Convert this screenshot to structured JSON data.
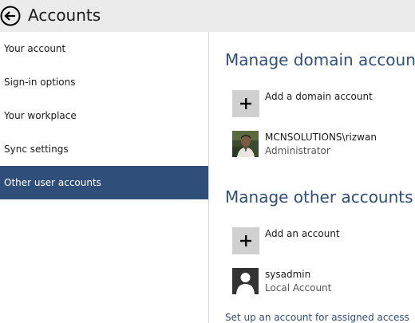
{
  "header": {
    "title": "Accounts",
    "back_icon": "back-arrow-circle-icon"
  },
  "sidebar": {
    "selected_color": "#2f4f7a",
    "items": [
      {
        "label": "Your account"
      },
      {
        "label": "Sign-in options"
      },
      {
        "label": "Your workplace"
      },
      {
        "label": "Sync settings"
      },
      {
        "label": "Other user accounts",
        "selected": true
      }
    ]
  },
  "main": {
    "accent_color": "#2f4f7a",
    "domain_section": {
      "title": "Manage domain accounts",
      "add_label": "Add a domain account",
      "account": {
        "name": "MCNSOLUTIONS\\rizwan",
        "role": "Administrator",
        "avatar": "user-photo"
      }
    },
    "other_section": {
      "title": "Manage other accounts",
      "add_label": "Add an account",
      "account": {
        "name": "sysadmin",
        "role": "Local Account",
        "avatar": "default-user-icon"
      }
    },
    "assigned_access_link": "Set up an account for assigned access"
  }
}
